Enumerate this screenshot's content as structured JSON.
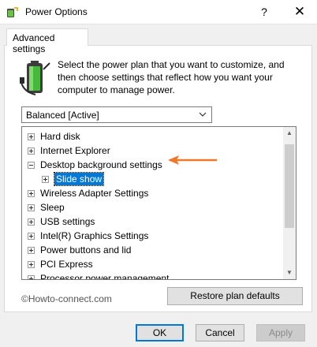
{
  "window": {
    "title": "Power Options",
    "help": "?",
    "close": "✕"
  },
  "tab": {
    "label": "Advanced settings"
  },
  "description": "Select the power plan that you want to customize, and then choose settings that reflect how you want your computer to manage power.",
  "plan_select": {
    "value": "Balanced [Active]"
  },
  "tree": {
    "items": [
      {
        "label": "Hard disk"
      },
      {
        "label": "Internet Explorer"
      },
      {
        "label": "Desktop background settings"
      },
      {
        "label": "Slide show"
      },
      {
        "label": "Wireless Adapter Settings"
      },
      {
        "label": "Sleep"
      },
      {
        "label": "USB settings"
      },
      {
        "label": "Intel(R) Graphics Settings"
      },
      {
        "label": "Power buttons and lid"
      },
      {
        "label": "PCI Express"
      },
      {
        "label": "Processor power management"
      }
    ]
  },
  "watermark": "©Howto-connect.com",
  "restore_button": "Restore plan defaults",
  "footer": {
    "ok": "OK",
    "cancel": "Cancel",
    "apply": "Apply"
  },
  "colors": {
    "selection": "#0078d7",
    "arrow": "#f0782d"
  }
}
